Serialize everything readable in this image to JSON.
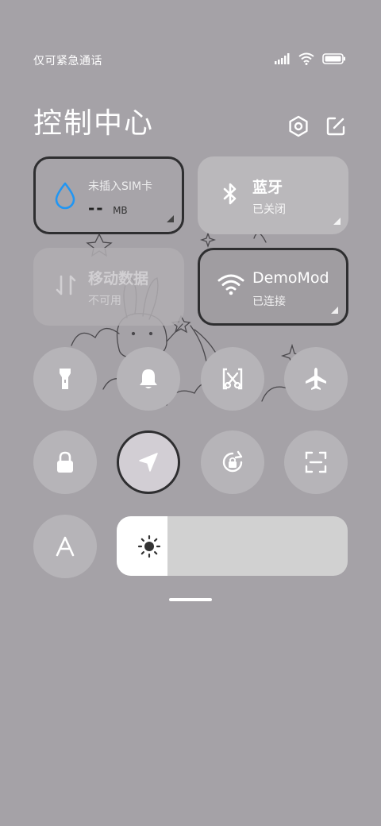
{
  "status_bar": {
    "carrier_text": "仅可紧急通话",
    "icons": [
      "signal-icon",
      "wifi-icon",
      "battery-icon"
    ]
  },
  "header": {
    "title": "控制中心",
    "buttons": [
      "settings-icon",
      "edit-icon"
    ]
  },
  "tiles": {
    "sim": {
      "title": "未插入SIM卡",
      "value": "--",
      "unit": "MB",
      "icon": "water-drop-icon"
    },
    "bluetooth": {
      "title": "蓝牙",
      "status": "已关闭",
      "icon": "bluetooth-icon"
    },
    "mobile_data": {
      "title": "移动数据",
      "status": "不可用",
      "icon": "data-arrows-icon"
    },
    "wifi": {
      "title": "DemoMod",
      "status": "已连接",
      "icon": "wifi-icon"
    }
  },
  "round_buttons": [
    {
      "name": "flashlight",
      "icon": "flashlight-icon"
    },
    {
      "name": "mute",
      "icon": "bell-icon"
    },
    {
      "name": "screenshot",
      "icon": "scissors-icon"
    },
    {
      "name": "airplane",
      "icon": "airplane-icon"
    },
    {
      "name": "lock",
      "icon": "lock-icon"
    },
    {
      "name": "location",
      "icon": "location-arrow-icon",
      "active": true
    },
    {
      "name": "rotation-lock",
      "icon": "rotation-lock-icon"
    },
    {
      "name": "scan",
      "icon": "scan-icon"
    },
    {
      "name": "font-size",
      "icon": "font-a-icon"
    }
  ],
  "brightness": {
    "level": 0.22,
    "icon": "sun-icon"
  },
  "colors": {
    "background": "#a5a2a7",
    "active_border": "#2e2e30",
    "accent_blue": "#2196f3"
  }
}
